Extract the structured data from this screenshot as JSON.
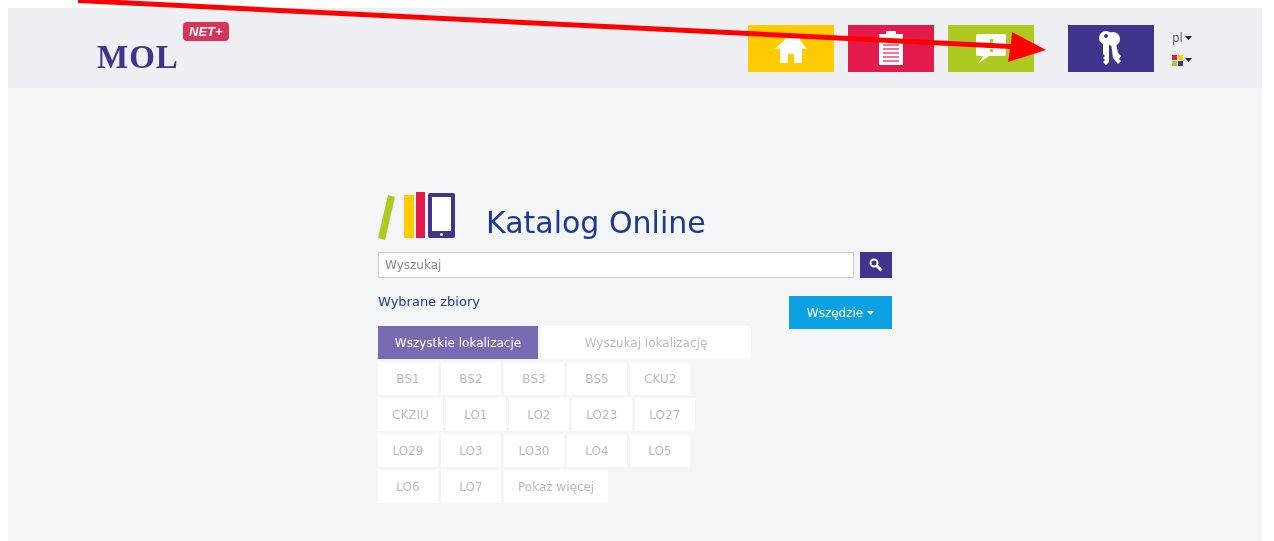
{
  "header": {
    "logo": {
      "text": "MOL",
      "badge": "NET+"
    },
    "nav_buttons": [
      {
        "kind": "home",
        "color": "#fecb00"
      },
      {
        "kind": "clipboard",
        "color": "#e31b4c"
      },
      {
        "kind": "chat",
        "color": "#aec91f"
      },
      {
        "kind": "keys",
        "color": "#3f358c"
      }
    ],
    "language": "pl"
  },
  "catalog": {
    "title": "Katalog Online",
    "search": {
      "placeholder": "Wyszukaj"
    },
    "collections_link": "Wybrane zbiory",
    "scope_button": "Wszędzie",
    "tabs": [
      {
        "label": "Wszystkie lokalizacje",
        "selected": true
      },
      {
        "label": "Wyszukaj lokalizację",
        "selected": false
      }
    ],
    "locations": [
      "BS1",
      "BS2",
      "BS3",
      "BS5",
      "CKU2",
      "CKZIU",
      "LO1",
      "LO2",
      "LO23",
      "LO27",
      "LO29",
      "LO3",
      "LO30",
      "LO4",
      "LO5",
      "LO6",
      "LO7"
    ],
    "show_more": "Pokaż więcej"
  }
}
